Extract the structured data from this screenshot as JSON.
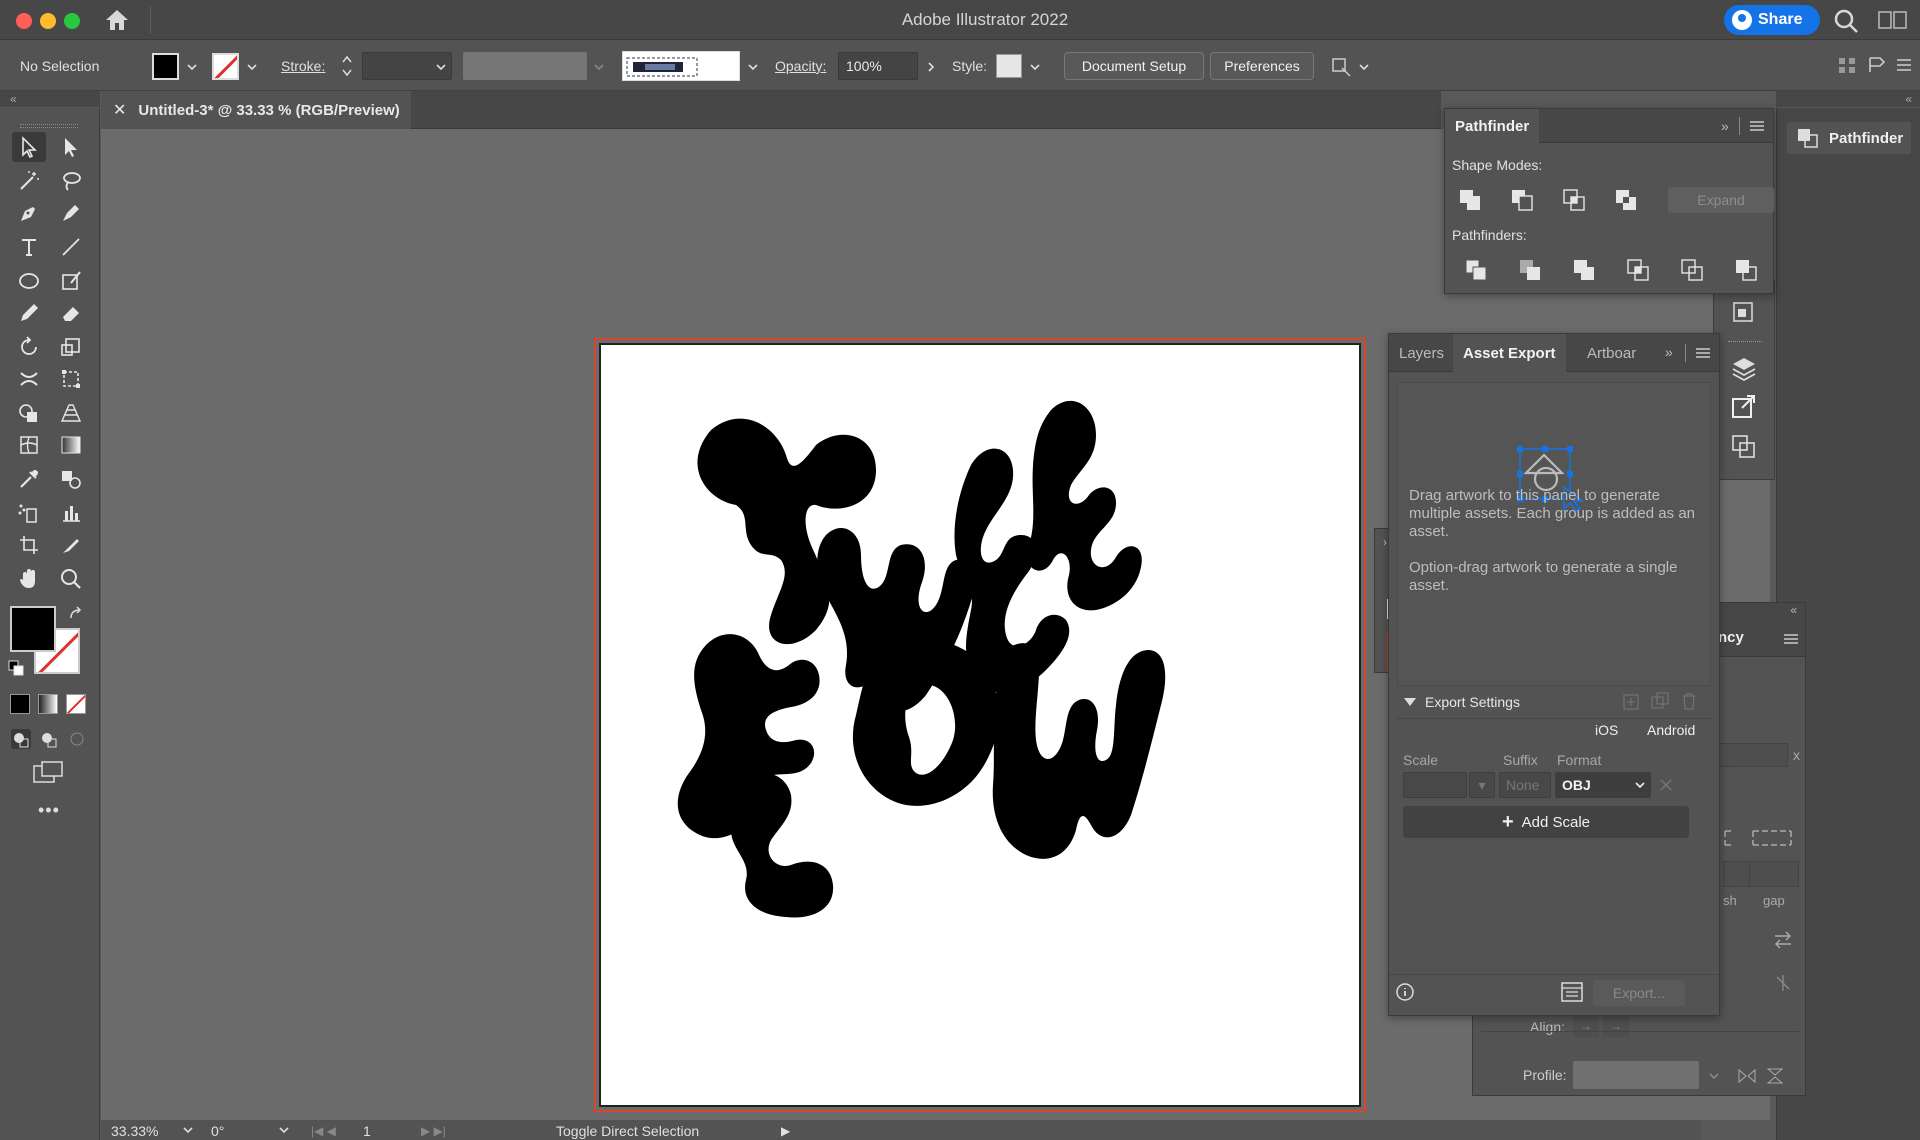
{
  "app": {
    "title": "Adobe Illustrator 2022",
    "share_label": "Share"
  },
  "control_bar": {
    "selection": "No Selection",
    "stroke_label": "Stroke:",
    "opacity_label": "Opacity:",
    "opacity_value": "100%",
    "style_label": "Style:",
    "document_setup": "Document Setup",
    "preferences": "Preferences"
  },
  "document": {
    "tab_title": "Untitled-3* @ 33.33 % (RGB/Preview)"
  },
  "artwork": {
    "description_icon": "the-flow-lettering"
  },
  "status_bar": {
    "zoom": "33.33%",
    "rotation": "0°",
    "artboard": "1",
    "hint": "Toggle Direct Selection"
  },
  "pathfinder": {
    "title": "Pathfinder",
    "shape_modes": "Shape Modes:",
    "expand": "Expand",
    "pathfinders": "Pathfinders:"
  },
  "asset_export": {
    "tabs": [
      "Layers",
      "Asset Export",
      "Artboar"
    ],
    "drop_text": "Drag artwork to this panel to generate multiple assets. Each group is added as an asset.",
    "option_text": "Option-drag artwork to generate a single asset.",
    "export_settings": "Export Settings",
    "ios": "iOS",
    "android": "Android",
    "scale_label": "Scale",
    "suffix_label": "Suffix",
    "format_label": "Format",
    "suffix_value": "None",
    "format_value": "OBJ",
    "add_scale": "Add Scale",
    "export_btn": "Export..."
  },
  "behind_panel": {
    "fragment_title": "ncy",
    "dash_label": "sh",
    "gap_label": "gap",
    "align_label": "Align:",
    "profile_label": "Profile:"
  },
  "right_dock": {
    "pathfinder_tab": "Pathfinder"
  },
  "colors": {
    "accent": "#1473e6",
    "artboard_border": "#d7452a"
  }
}
